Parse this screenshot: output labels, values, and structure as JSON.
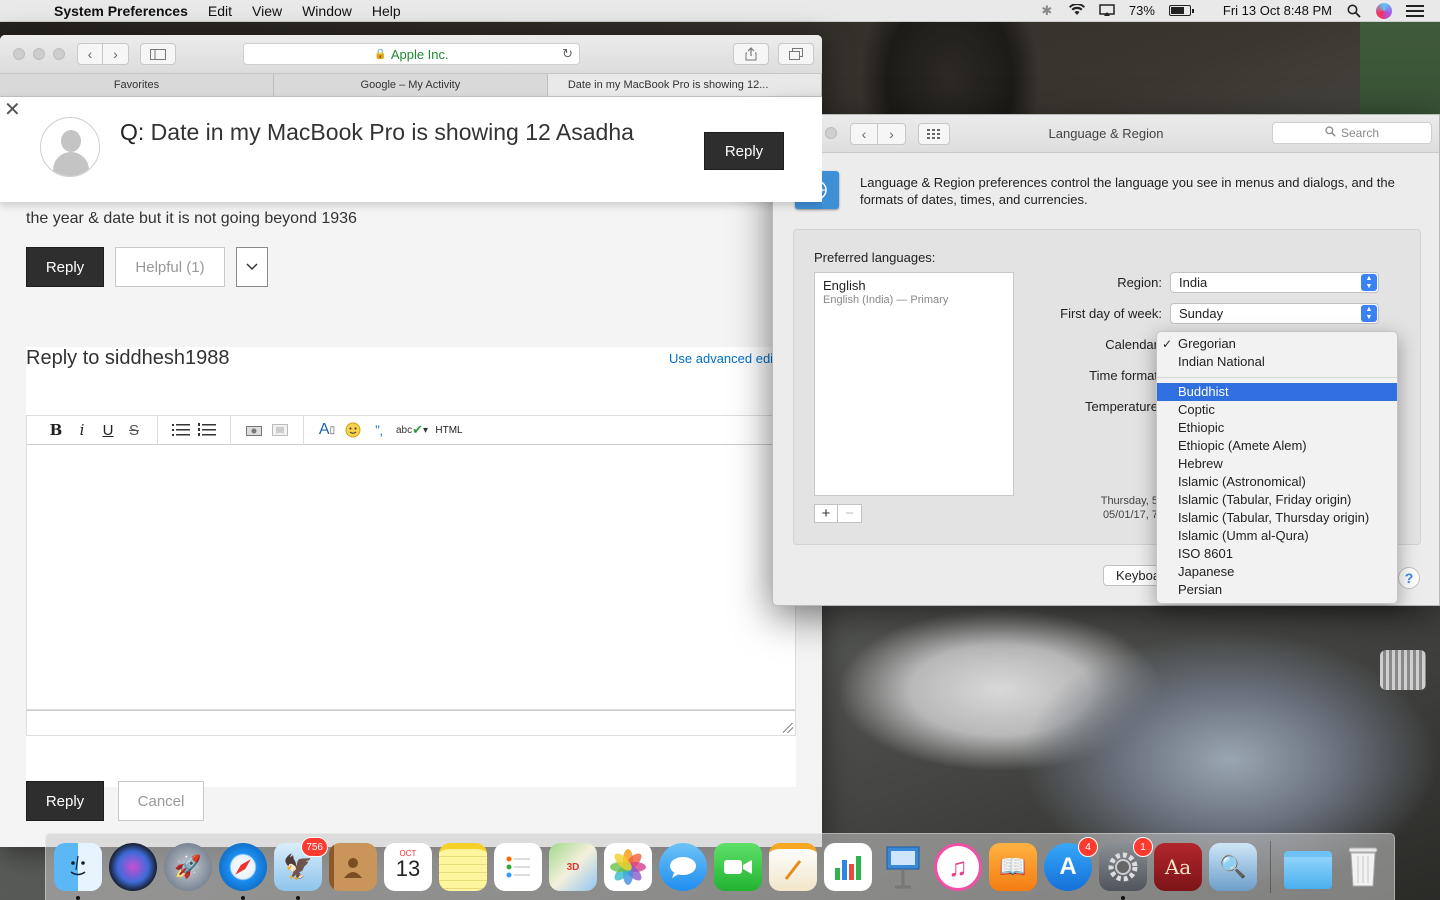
{
  "menubar": {
    "apple": "",
    "app_name": "System Preferences",
    "menus": [
      "Edit",
      "View",
      "Window",
      "Help"
    ],
    "battery_percent": "73%",
    "battery_level": 0.73,
    "datetime": "Fri 13 Oct  8:48 PM"
  },
  "safari": {
    "url": "Apple Inc.",
    "tabs": [
      "Favorites",
      "Google – My Activity",
      "Date in my MacBook Pro is showing 12..."
    ],
    "page": {
      "question_prefix": "Q:",
      "question_title": " Date in my MacBook Pro is showing 12 Asadha",
      "reply_label": "Reply",
      "body_text": "the year & date but it is not going beyond 1936",
      "helpful_label": "Helpful (1)",
      "reply_to": "Reply to siddhesh1988",
      "advanced_editor": "Use advanced edit",
      "toolbar_html": "HTML",
      "cancel_label": "Cancel"
    }
  },
  "prefs": {
    "title": "Language & Region",
    "search_placeholder": "Search",
    "description": "Language & Region preferences control the language you see in menus and dialogs, and the formats of dates, times, and currencies.",
    "preferred_languages_label": "Preferred languages:",
    "language": {
      "name": "English",
      "sub": "English (India) — Primary"
    },
    "region_label": "Region:",
    "region_value": "India",
    "first_day_label": "First day of week:",
    "first_day_value": "Sunday",
    "calendar_label": "Calendar",
    "time_format_label": "Time format",
    "temperature_label": "Temperature",
    "sample_line1": "Thursday, 5",
    "sample_line2": "05/01/17, 7",
    "keyboard_label": "Keyboa",
    "help_label": "?"
  },
  "calendar_menu": {
    "top": [
      {
        "label": "Gregorian",
        "checked": true
      },
      {
        "label": "Indian National",
        "checked": false
      }
    ],
    "items": [
      {
        "label": "Buddhist",
        "selected": true
      },
      {
        "label": "Coptic"
      },
      {
        "label": "Ethiopic"
      },
      {
        "label": "Ethiopic (Amete Alem)"
      },
      {
        "label": "Hebrew"
      },
      {
        "label": "Islamic (Astronomical)"
      },
      {
        "label": "Islamic (Tabular, Friday origin)"
      },
      {
        "label": "Islamic (Tabular, Thursday origin)"
      },
      {
        "label": "Islamic (Umm al-Qura)"
      },
      {
        "label": "ISO 8601"
      },
      {
        "label": "Japanese"
      },
      {
        "label": "Persian"
      }
    ]
  },
  "dock": {
    "calendar_month": "OCT",
    "calendar_day": "13",
    "mail_badge": "756",
    "appstore_badge": "4",
    "sysprefs_badge": "1",
    "dictionary_label": "Aa"
  }
}
